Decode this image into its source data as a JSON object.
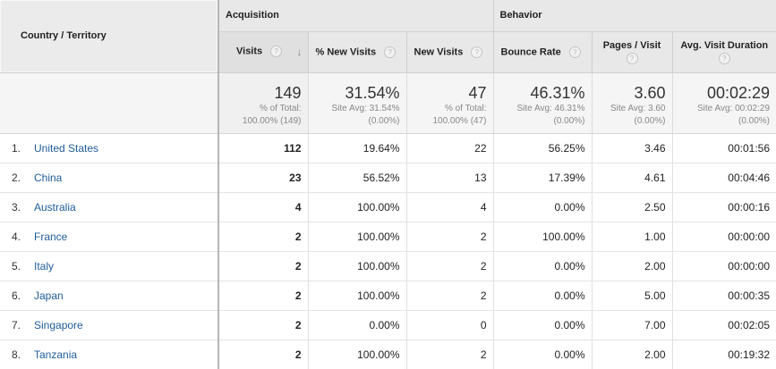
{
  "headers": {
    "country": "Country / Territory",
    "acquisition": "Acquisition",
    "behavior": "Behavior",
    "visits": "Visits",
    "pct_new_visits": "% New Visits",
    "new_visits": "New Visits",
    "bounce_rate": "Bounce Rate",
    "pages_per_visit": "Pages / Visit",
    "avg_visit_duration": "Avg. Visit Duration",
    "help_glyph": "?",
    "sort_glyph": "↓"
  },
  "summary": {
    "visits": {
      "value": "149",
      "l1": "% of Total:",
      "l2": "100.00% (149)"
    },
    "pct_new_visits": {
      "value": "31.54%",
      "l1": "Site Avg: 31.54%",
      "l2": "(0.00%)"
    },
    "new_visits": {
      "value": "47",
      "l1": "% of Total:",
      "l2": "100.00% (47)"
    },
    "bounce_rate": {
      "value": "46.31%",
      "l1": "Site Avg: 46.31%",
      "l2": "(0.00%)"
    },
    "pages_per_visit": {
      "value": "3.60",
      "l1": "Site Avg: 3.60",
      "l2": "(0.00%)"
    },
    "avg_visit_duration": {
      "value": "00:02:29",
      "l1": "Site Avg: 00:02:29",
      "l2": "(0.00%)"
    }
  },
  "rows": [
    {
      "idx": "1.",
      "country": "United States",
      "visits": "112",
      "pct_new": "19.64%",
      "new_visits": "22",
      "bounce": "56.25%",
      "pages": "3.46",
      "duration": "00:01:56"
    },
    {
      "idx": "2.",
      "country": "China",
      "visits": "23",
      "pct_new": "56.52%",
      "new_visits": "13",
      "bounce": "17.39%",
      "pages": "4.61",
      "duration": "00:04:46"
    },
    {
      "idx": "3.",
      "country": "Australia",
      "visits": "4",
      "pct_new": "100.00%",
      "new_visits": "4",
      "bounce": "0.00%",
      "pages": "2.50",
      "duration": "00:00:16"
    },
    {
      "idx": "4.",
      "country": "France",
      "visits": "2",
      "pct_new": "100.00%",
      "new_visits": "2",
      "bounce": "100.00%",
      "pages": "1.00",
      "duration": "00:00:00"
    },
    {
      "idx": "5.",
      "country": "Italy",
      "visits": "2",
      "pct_new": "100.00%",
      "new_visits": "2",
      "bounce": "0.00%",
      "pages": "2.00",
      "duration": "00:00:00"
    },
    {
      "idx": "6.",
      "country": "Japan",
      "visits": "2",
      "pct_new": "100.00%",
      "new_visits": "2",
      "bounce": "0.00%",
      "pages": "5.00",
      "duration": "00:00:35"
    },
    {
      "idx": "7.",
      "country": "Singapore",
      "visits": "2",
      "pct_new": "0.00%",
      "new_visits": "0",
      "bounce": "0.00%",
      "pages": "7.00",
      "duration": "00:02:05"
    },
    {
      "idx": "8.",
      "country": "Tanzania",
      "visits": "2",
      "pct_new": "100.00%",
      "new_visits": "2",
      "bounce": "0.00%",
      "pages": "2.00",
      "duration": "00:19:32"
    }
  ]
}
